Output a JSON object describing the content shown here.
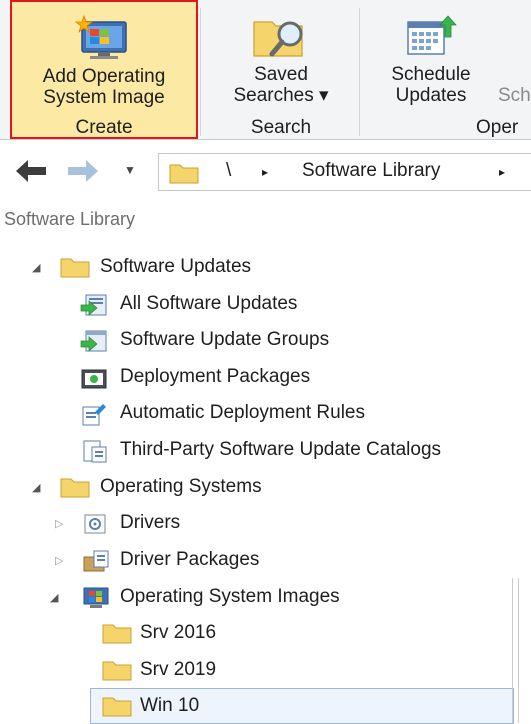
{
  "ribbon": {
    "buttons": [
      {
        "label_line1": "Add Operating",
        "label_line2": "System Image",
        "group": "Create",
        "icon": "add-os-image-icon"
      },
      {
        "label_line1": "Saved",
        "label_line2": "Searches ▾",
        "group": "Search",
        "icon": "saved-searches-icon"
      },
      {
        "label_line1": "Schedule",
        "label_line2": "Updates",
        "group": "Oper",
        "icon": "schedule-updates-icon"
      }
    ],
    "partial_label": "Sch"
  },
  "address_bar": {
    "root_sep": "\\",
    "crumb": "Software Library",
    "arrow": "▸"
  },
  "tree": {
    "title": "Software Library",
    "software_updates": {
      "label": "Software Updates",
      "children": [
        {
          "label": "All Software Updates",
          "icon": "all-software-updates-icon"
        },
        {
          "label": "Software Update Groups",
          "icon": "software-update-groups-icon"
        },
        {
          "label": "Deployment Packages",
          "icon": "deployment-packages-icon"
        },
        {
          "label": "Automatic Deployment Rules",
          "icon": "automatic-deployment-rules-icon"
        },
        {
          "label": "Third-Party Software Update Catalogs",
          "icon": "third-party-catalogs-icon"
        }
      ]
    },
    "operating_systems": {
      "label": "Operating Systems",
      "children": [
        {
          "label": "Drivers",
          "icon": "drivers-icon"
        },
        {
          "label": "Driver Packages",
          "icon": "driver-packages-icon"
        },
        {
          "label": "Operating System Images",
          "icon": "os-images-icon",
          "children": [
            {
              "label": "Srv 2016"
            },
            {
              "label": "Srv 2019"
            },
            {
              "label": "Win 10",
              "selected": true
            }
          ]
        }
      ]
    }
  },
  "colors": {
    "ribbon_bg": "#f3f4f6",
    "highlight_bg": "#fce9a4",
    "highlight_border": "#e0161c",
    "folder": "#f5d46b",
    "selection_bg": "#eef4fb"
  }
}
